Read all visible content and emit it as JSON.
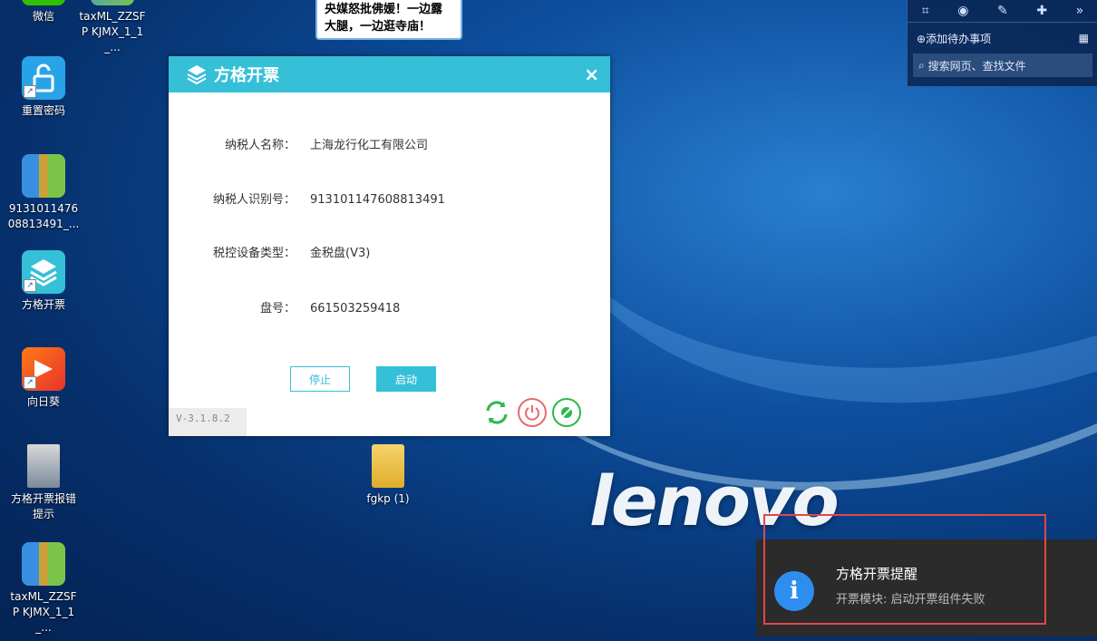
{
  "news": {
    "text_line1": "央媒怒批佛媛！一边露",
    "text_line2": "大腿，一边逛寺庙！"
  },
  "desktop": {
    "wechat": "微信",
    "taxml_top": "taxML_ZZSFP KJMX_1_1_...",
    "reset_password": "重置密码",
    "archive_9131": "9131011476 08813491_...",
    "fanggekaipiao": "方格开票",
    "xiangrikui": "向日葵",
    "error_tip": "方格开票报错提示",
    "taxml_bottom": "taxML_ZZSFP KJMX_1_1_...",
    "fgkp_folder": "fgkp (1)",
    "brand": "lenovo"
  },
  "widget": {
    "add_todo": "添加待办事项",
    "search": "搜索网页、查找文件"
  },
  "dialog": {
    "title": "方格开票",
    "fields": [
      {
        "label": "纳税人名称：",
        "value": "上海龙行化工有限公司"
      },
      {
        "label": "纳税人识别号：",
        "value": "913101147608813491"
      },
      {
        "label": "税控设备类型：",
        "value": "金税盘(V3)"
      },
      {
        "label": "盘号：",
        "value": "661503259418"
      }
    ],
    "stop_label": "停止",
    "start_label": "启动",
    "version": "V-3.1.8.2"
  },
  "notification": {
    "title": "方格开票提醒",
    "message": "开票模块: 启动开票组件失败"
  },
  "colors": {
    "accent": "#35c0d8",
    "info": "#2e8ef0",
    "highlight": "#e04848"
  }
}
